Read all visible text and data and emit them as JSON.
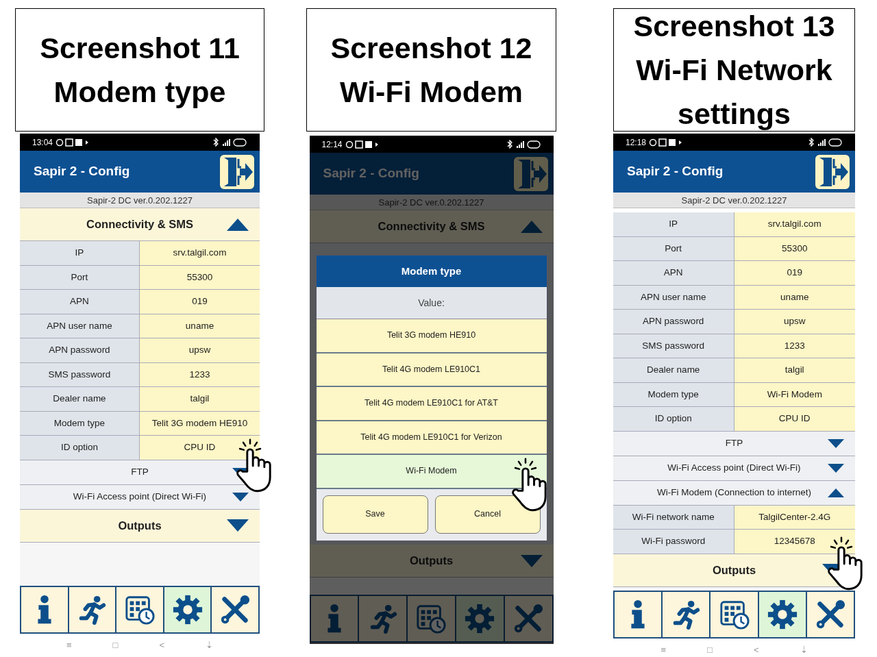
{
  "panels": [
    {
      "caption": [
        "Screenshot 11",
        "Modem type"
      ],
      "phone": {
        "time": "13:04",
        "title": "Sapir 2 - Config",
        "version": "Sapir-2 DC ver.0.202.1227",
        "items": [
          {
            "kind": "section",
            "label": "Connectivity & SMS",
            "expanded": true
          },
          {
            "kind": "field",
            "label": "IP",
            "value": "srv.talgil.com"
          },
          {
            "kind": "field",
            "label": "Port",
            "value": "55300"
          },
          {
            "kind": "field",
            "label": "APN",
            "value": "019"
          },
          {
            "kind": "field",
            "label": "APN user name",
            "value": "uname"
          },
          {
            "kind": "field",
            "label": "APN password",
            "value": "upsw"
          },
          {
            "kind": "field",
            "label": "SMS password",
            "value": "1233"
          },
          {
            "kind": "field",
            "label": "Dealer name",
            "value": "talgil"
          },
          {
            "kind": "field",
            "label": "Modem type",
            "value": "Telit 3G modem HE910"
          },
          {
            "kind": "field",
            "label": "ID option",
            "value": "CPU ID"
          },
          {
            "kind": "subsection",
            "label": "FTP",
            "expanded": false
          },
          {
            "kind": "subsection",
            "label": "Wi-Fi Access point (Direct Wi-Fi)",
            "expanded": false
          },
          {
            "kind": "section",
            "label": "Outputs",
            "expanded": false
          }
        ],
        "nav": [
          {
            "selected": false
          },
          {
            "selected": false
          },
          {
            "selected": false
          },
          {
            "selected": true
          },
          {
            "selected": false
          }
        ],
        "system_nav": [
          "≡",
          "□",
          "<",
          "⇣"
        ]
      }
    },
    {
      "caption": [
        "Screenshot 12",
        "Wi-Fi Modem"
      ],
      "phone": {
        "time": "12:14",
        "title": "Sapir 2 - Config",
        "version": "Sapir-2 DC ver.0.202.1227",
        "items": [
          {
            "kind": "section",
            "label": "Connectivity & SMS",
            "expanded": true
          },
          {
            "kind": "section",
            "label": "Outputs",
            "expanded": false
          }
        ],
        "nav": [
          {
            "selected": false
          },
          {
            "selected": false
          },
          {
            "selected": false
          },
          {
            "selected": true
          },
          {
            "selected": false
          }
        ],
        "dialog": {
          "title": "Modem type",
          "prompt": "Value:",
          "options": [
            {
              "label": "Telit 3G modem HE910",
              "selected": false
            },
            {
              "label": "Telit 4G modem LE910C1",
              "selected": false
            },
            {
              "label": "Telit 4G modem LE910C1 for AT&T",
              "selected": false
            },
            {
              "label": "Telit 4G modem LE910C1 for Verizon",
              "selected": false
            },
            {
              "label": "Wi-Fi Modem",
              "selected": true
            }
          ],
          "buttons": [
            "Save",
            "Cancel"
          ]
        }
      }
    },
    {
      "caption": [
        "Screenshot 13",
        "Wi-Fi Network",
        "settings"
      ],
      "phone": {
        "time": "12:18",
        "title": "Sapir 2 - Config",
        "version": "Sapir-2 DC ver.0.202.1227",
        "items": [
          {
            "kind": "field",
            "label": "IP",
            "value": "srv.talgil.com"
          },
          {
            "kind": "field",
            "label": "Port",
            "value": "55300"
          },
          {
            "kind": "field",
            "label": "APN",
            "value": "019"
          },
          {
            "kind": "field",
            "label": "APN user name",
            "value": "uname"
          },
          {
            "kind": "field",
            "label": "APN password",
            "value": "upsw"
          },
          {
            "kind": "field",
            "label": "SMS password",
            "value": "1233"
          },
          {
            "kind": "field",
            "label": "Dealer name",
            "value": "talgil"
          },
          {
            "kind": "field",
            "label": "Modem type",
            "value": "Wi-Fi Modem"
          },
          {
            "kind": "field",
            "label": "ID option",
            "value": "CPU ID"
          },
          {
            "kind": "subsection",
            "label": "FTP",
            "expanded": false
          },
          {
            "kind": "subsection",
            "label": "Wi-Fi Access point (Direct Wi-Fi)",
            "expanded": false
          },
          {
            "kind": "subsection",
            "label": "Wi-Fi Modem (Connection to internet)",
            "expanded": true
          },
          {
            "kind": "field",
            "label": "Wi-Fi network name",
            "value": "TalgilCenter-2.4G"
          },
          {
            "kind": "field",
            "label": "Wi-Fi password",
            "value": "12345678"
          },
          {
            "kind": "section",
            "label": "Outputs",
            "expanded": false
          }
        ],
        "nav": [
          {
            "selected": false
          },
          {
            "selected": false
          },
          {
            "selected": false
          },
          {
            "selected": true
          },
          {
            "selected": false
          }
        ],
        "system_nav": [
          "≡",
          "□",
          "<",
          "⇣"
        ]
      }
    }
  ]
}
